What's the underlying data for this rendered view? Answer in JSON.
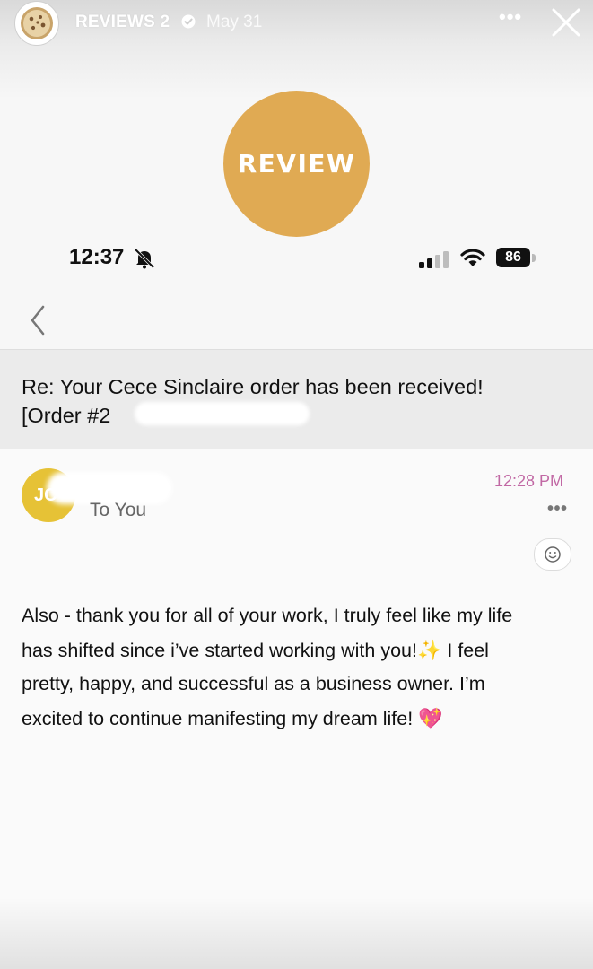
{
  "story": {
    "account_name": "REVIEWS 2",
    "date": "May 31",
    "more_label": "•••",
    "icons": {
      "avatar": "cookie-logo-icon",
      "verified": "verified-badge-icon",
      "close": "close-icon"
    }
  },
  "badge": {
    "label": "REVIEW",
    "color": "#e0aa53"
  },
  "phone_status": {
    "time": "12:37",
    "battery": "86",
    "icons": [
      "bell-slash-icon",
      "signal-bars-icon",
      "wifi-icon",
      "battery-icon"
    ]
  },
  "email": {
    "back_icon": "chevron-left-icon",
    "subject_line1": "Re: Your Cece Sinclaire order has been received!",
    "subject_line2": "[Order #2",
    "sender_initials": "JC",
    "sender_name_visible": "....",
    "recipient": "To You",
    "time": "12:28 PM",
    "time_color": "#c168a4",
    "more_label": "•••",
    "reaction_icon": "smiley-icon",
    "avatar_color": "#e6c236",
    "body_lines": [
      "Also - thank you for all of your work, I truly feel like my life",
      "has shifted since i’ve started working with you!",
      " I feel",
      "pretty, happy, and successful as a business owner. I’m",
      "excited to continue manifesting my dream life!"
    ],
    "emoji_sparkles": "✨",
    "emoji_heart": "💖"
  }
}
